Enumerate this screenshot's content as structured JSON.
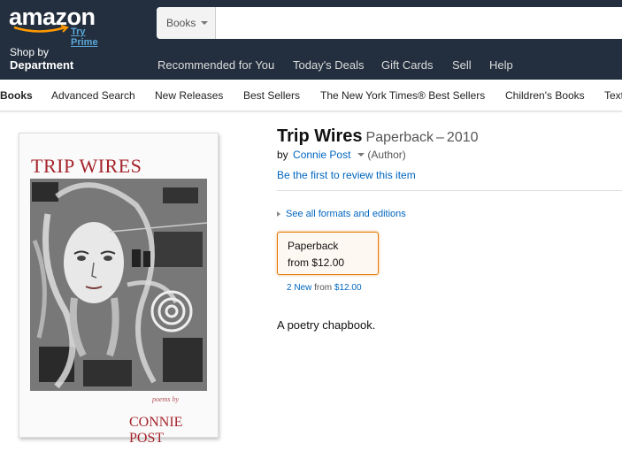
{
  "header": {
    "logo_text": "amazon",
    "try_prime": "Try Prime",
    "search": {
      "category": "Books",
      "value": "",
      "placeholder": ""
    },
    "shop_by": "Shop by",
    "department": "Department",
    "nav_links": [
      "Recommended for You",
      "Today's Deals",
      "Gift Cards",
      "Sell",
      "Help"
    ]
  },
  "subnav": {
    "items": [
      "Books",
      "Advanced Search",
      "New Releases",
      "Best Sellers",
      "The New York Times® Best Sellers",
      "Children's Books",
      "Textbooks"
    ]
  },
  "cover": {
    "title": "TRIP WIRES",
    "poems_by": "poems by",
    "author": "CONNIE POST"
  },
  "product": {
    "title": "Trip Wires",
    "format": "Paperback",
    "separator": "–",
    "year": "2010",
    "by": "by",
    "author": "Connie Post",
    "author_role": "(Author)",
    "review_link": "Be the first to review this item",
    "formats_link": "See all formats and editions",
    "format_box": {
      "name": "Paperback",
      "price": "from $12.00"
    },
    "new_offers": {
      "count": "2 New",
      "from": "from",
      "price": "$12.00"
    },
    "description": "A poetry chapbook."
  },
  "colors": {
    "header_bg": "#232f3e",
    "link": "#0066c0",
    "accent_orange": "#e77600",
    "cover_red": "#a5242c"
  }
}
